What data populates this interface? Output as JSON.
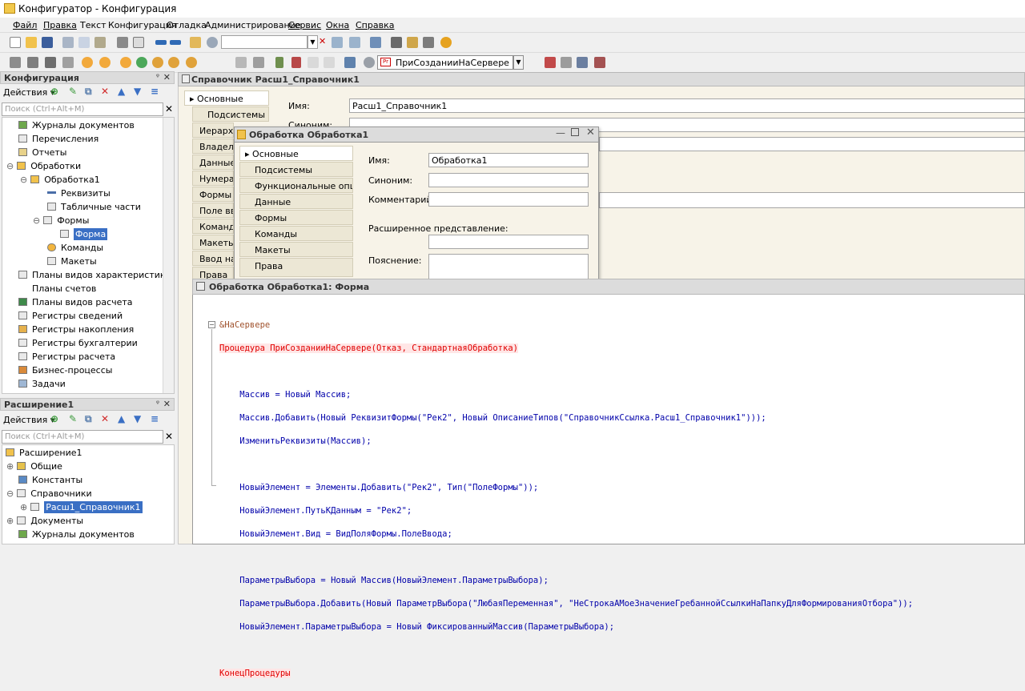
{
  "app": {
    "title": "Конфигуратор - Конфигурация"
  },
  "menu": [
    "Файл",
    "Правка",
    "Текст",
    "Конфигурация",
    "Отладка",
    "Администрирование",
    "Сервис",
    "Окна",
    "Справка"
  ],
  "toolbar": {
    "procedure": "ПриСозданииНаСервере",
    "search_value": ""
  },
  "config_panel": {
    "title": "Конфигурация",
    "pin": "ᵠ",
    "actions": "Действия ▾",
    "search_placeholder": "Поиск (Ctrl+Alt+M)",
    "items": [
      {
        "label": "Журналы документов",
        "icon": "journal-icon"
      },
      {
        "label": "Перечисления",
        "icon": "enum-icon"
      },
      {
        "label": "Отчеты",
        "icon": "report-icon"
      },
      {
        "label": "Обработки",
        "icon": "processing-icon"
      },
      {
        "label": "Обработка1",
        "icon": "processing-icon"
      },
      {
        "label": "Реквизиты",
        "icon": "attribute-icon"
      },
      {
        "label": "Табличные части",
        "icon": "table-icon"
      },
      {
        "label": "Формы",
        "icon": "form-icon"
      },
      {
        "label": "Форма",
        "icon": "form-icon"
      },
      {
        "label": "Команды",
        "icon": "command-icon"
      },
      {
        "label": "Макеты",
        "icon": "template-icon"
      },
      {
        "label": "Планы видов характеристик",
        "icon": "chart-icon"
      },
      {
        "label": "Планы счетов",
        "icon": "accounts-icon"
      },
      {
        "label": "Планы видов расчета",
        "icon": "calc-icon"
      },
      {
        "label": "Регистры сведений",
        "icon": "register-icon"
      },
      {
        "label": "Регистры накопления",
        "icon": "register-icon"
      },
      {
        "label": "Регистры бухгалтерии",
        "icon": "register-icon"
      },
      {
        "label": "Регистры расчета",
        "icon": "register-icon"
      },
      {
        "label": "Бизнес-процессы",
        "icon": "process-icon"
      },
      {
        "label": "Задачи",
        "icon": "task-icon"
      }
    ]
  },
  "ext_panel": {
    "title": "Расширение1",
    "actions": "Действия ▾",
    "search_placeholder": "Поиск (Ctrl+Alt+M)",
    "items": [
      {
        "label": "Расширение1"
      },
      {
        "label": "Общие"
      },
      {
        "label": "Константы"
      },
      {
        "label": "Справочники"
      },
      {
        "label": "Расш1_Справочник1"
      },
      {
        "label": "Документы"
      },
      {
        "label": "Журналы документов"
      }
    ]
  },
  "catalog_window": {
    "title": "Справочник Расш1_Справочник1",
    "tabs": [
      "Основные",
      "Подсистемы",
      "Иерархия",
      "Владельцы",
      "Данные",
      "Нумерация",
      "Формы",
      "Поле ввода",
      "Команды",
      "Макеты",
      "Ввод на основании",
      "Права"
    ],
    "name_label": "Имя:",
    "name_value": "Расш1_Справочник1",
    "synonym_label": "Синоним:"
  },
  "processing_window": {
    "title": "Обработка Обработка1",
    "tabs": [
      "Основные",
      "Подсистемы",
      "Функциональные опции",
      "Данные",
      "Формы",
      "Команды",
      "Макеты",
      "Права"
    ],
    "name_label": "Имя:",
    "name_value": "Обработка1",
    "synonym_label": "Синоним:",
    "comment_label": "Комментарий:",
    "ext_repr_label": "Расширенное представление:",
    "explanation_label": "Пояснение:"
  },
  "form_window": {
    "title": "Обработка Обработка1: Форма",
    "code": [
      "&НаСервере",
      "Процедура ПриСозданииНаСервере(Отказ, СтандартнаяОбработка)",
      "",
      "    Массив = Новый Массив;",
      "    Массив.Добавить(Новый РеквизитФормы(\"Рек2\", Новый ОписаниеТипов(\"СправочникСсылка.Расш1_Справочник1\")));",
      "    ИзменитьРеквизиты(Массив);",
      "",
      "    НовыйЭлемент = Элементы.Добавить(\"Рек2\", Тип(\"ПолеФормы\"));",
      "    НовыйЭлемент.ПутьКДанным = \"Рек2\";",
      "    НовыйЭлемент.Вид = ВидПоляФормы.ПолеВвода;",
      "",
      "    ПараметрыВыбора = Новый Массив(НовыйЭлемент.ПараметрыВыбора);",
      "    ПараметрыВыбора.Добавить(Новый ПараметрВыбора(\"ЛюбаяПеременная\", \"НеСтрокаАМоеЗначениеГребаннойСсылкиНаПапкуДляФормированияОтбора\"));",
      "    НовыйЭлемент.ПараметрыВыбора = Новый ФиксированныйМассив(ПараметрыВыбора);",
      "",
      "КонецПроцедуры"
    ]
  }
}
